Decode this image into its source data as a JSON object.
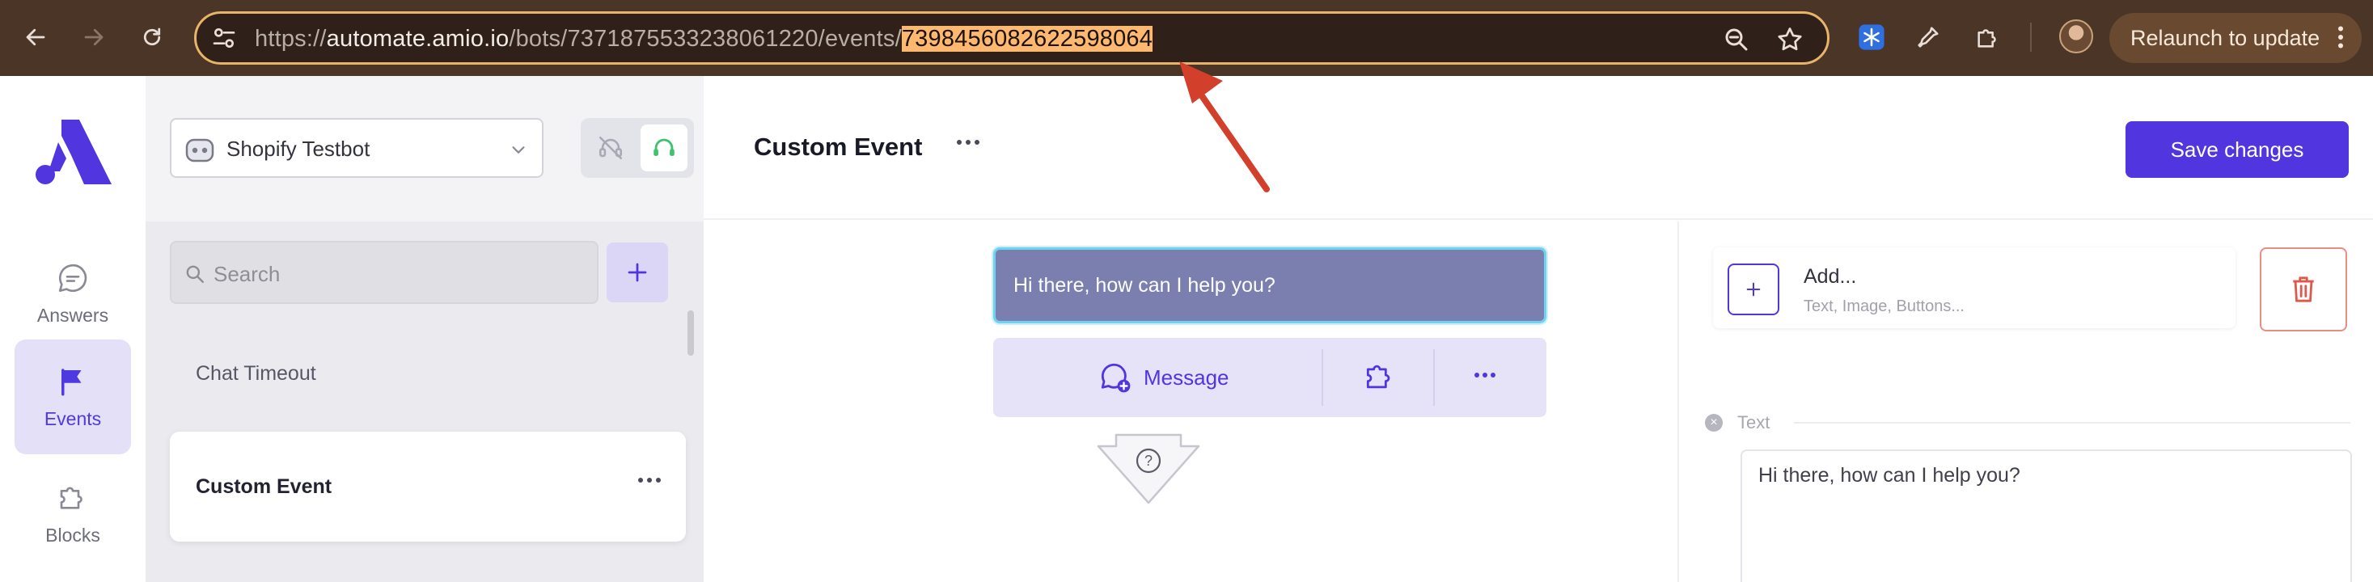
{
  "browser": {
    "url_prefix": "https://",
    "url_host": "automate.amio.io",
    "url_path": "/bots/7371875533238061220/events/",
    "url_highlighted_id": "7398456082622598064",
    "relaunch_label": "Relaunch to update",
    "icons": [
      "back-icon",
      "forward-icon",
      "reload-icon",
      "site-info-icon",
      "zoom-icon",
      "bookmark-star-icon",
      "extension-snowflake-icon",
      "eyedropper-icon",
      "puzzle-extensions-icon",
      "profile-avatar",
      "kebab-menu-icon"
    ]
  },
  "rail": {
    "items": [
      {
        "label": "Answers",
        "icon": "chat-bubble-icon",
        "active": false
      },
      {
        "label": "Events",
        "icon": "flag-icon",
        "active": true
      },
      {
        "label": "Blocks",
        "icon": "puzzle-icon",
        "active": false
      }
    ]
  },
  "panel": {
    "bot_name": "Shopify Testbot",
    "search_placeholder": "Search",
    "items": [
      {
        "label": "Chat Timeout"
      },
      {
        "label": "Custom Event",
        "selected": true
      }
    ]
  },
  "header": {
    "title": "Custom Event",
    "save_label": "Save changes"
  },
  "canvas": {
    "bubble_text": "Hi there, how can I help you?",
    "message_button_label": "Message",
    "flow_end_glyph": "?"
  },
  "inspector": {
    "add_title": "Add...",
    "add_subtitle": "Text, Image, Buttons...",
    "section_label": "Text",
    "text_value": "Hi there, how can I help you?"
  },
  "colors": {
    "accent": "#5136e0",
    "bubble": "#7b7fb0",
    "bubble_border": "#6fd3ef",
    "chrome_bg": "#4a3526",
    "url_highlight": "#ffb870",
    "annotation_arrow": "#d2402c",
    "delete_red": "#e0584b"
  }
}
